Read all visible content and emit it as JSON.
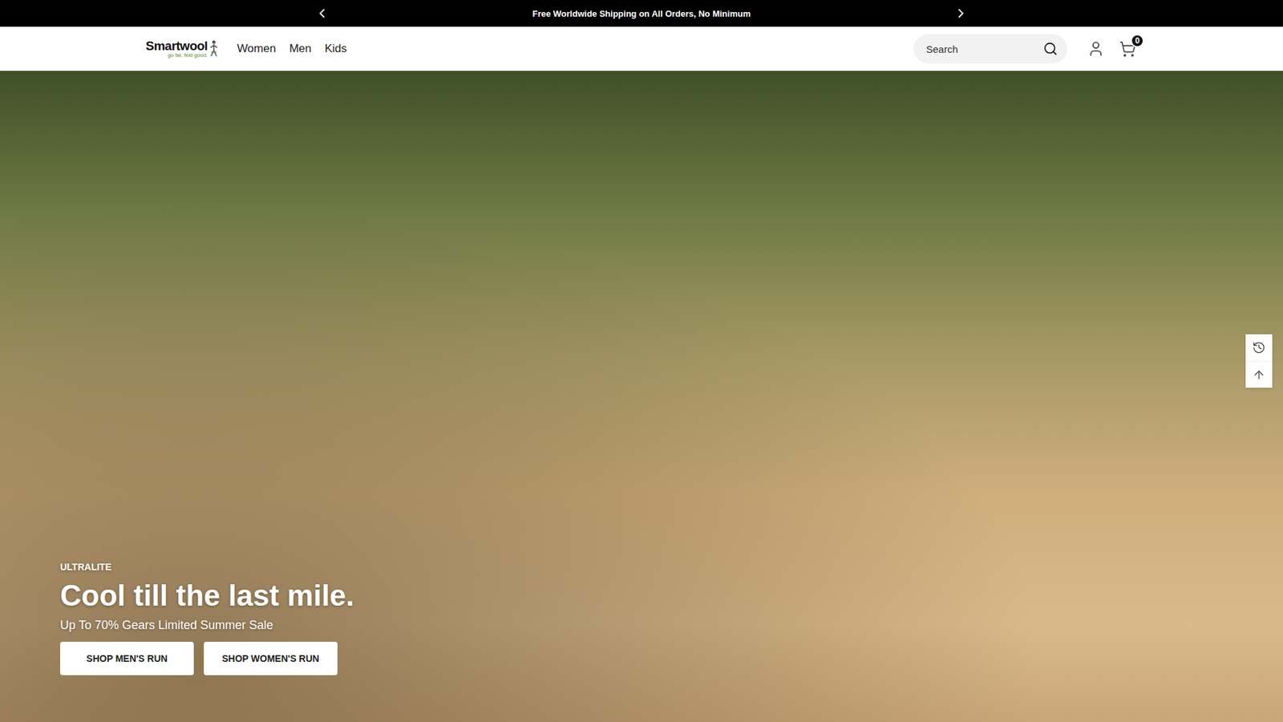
{
  "announcement": {
    "text": "Free Worldwide Shipping on All Orders, No Minimum"
  },
  "header": {
    "logo": "Smartwool",
    "tagline": "go far. feel good.",
    "nav": [
      "Women",
      "Men",
      "Kids"
    ],
    "search": {
      "placeholder": "Search"
    },
    "cart_count": "0"
  },
  "hero": {
    "eyebrow": "ULTRALITE",
    "title": "Cool till the last mile.",
    "subtitle": "Up To 70% Gears Limited Summer Sale",
    "buttons": [
      "SHOP MEN'S RUN",
      "SHOP WOMEN'S RUN"
    ]
  }
}
